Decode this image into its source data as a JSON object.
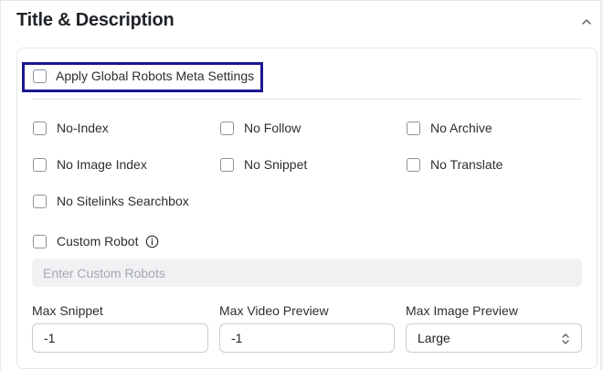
{
  "section": {
    "title": "Title & Description",
    "collapse_icon": "chevron-up-icon"
  },
  "global": {
    "label": "Apply Global Robots Meta Settings",
    "checked": false,
    "highlight_color": "#1a1791"
  },
  "robots": {
    "options": [
      {
        "label": "No-Index",
        "checked": false
      },
      {
        "label": "No Follow",
        "checked": false
      },
      {
        "label": "No Archive",
        "checked": false
      },
      {
        "label": "No Image Index",
        "checked": false
      },
      {
        "label": "No Snippet",
        "checked": false
      },
      {
        "label": "No Translate",
        "checked": false
      },
      {
        "label": "No Sitelinks Searchbox",
        "checked": false
      }
    ]
  },
  "custom": {
    "label": "Custom Robot",
    "info_icon": "info-icon",
    "placeholder": "Enter Custom Robots",
    "value": ""
  },
  "fields": {
    "max_snippet": {
      "label": "Max Snippet",
      "value": "-1"
    },
    "max_video_preview": {
      "label": "Max Video Preview",
      "value": "-1"
    },
    "max_image_preview": {
      "label": "Max Image Preview",
      "value": "Large"
    }
  }
}
